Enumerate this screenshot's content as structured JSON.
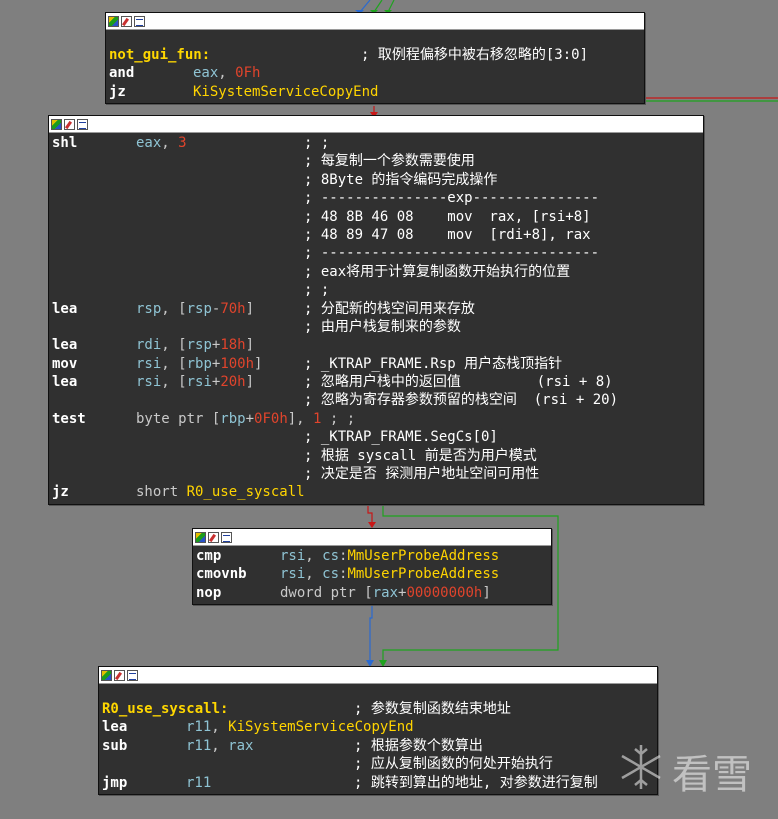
{
  "blocks": {
    "b1": {
      "label": "not_gui_fun:",
      "label_comment": "; 取例程偏移中被右移忽略的[3:0]",
      "lines": [
        {
          "mn": "and",
          "op": [
            {
              "t": "eax",
              "c": "reg"
            },
            {
              "t": ", ",
              "c": "ops"
            },
            {
              "t": "0Fh",
              "c": "num"
            }
          ],
          "cm": ""
        },
        {
          "mn": "jz",
          "op": [
            {
              "t": "KiSystemServiceCopyEnd",
              "c": "sym"
            }
          ],
          "cm": ""
        }
      ]
    },
    "b2": {
      "lines": [
        {
          "mn": "shl",
          "op": [
            {
              "t": "eax",
              "c": "reg"
            },
            {
              "t": ", ",
              "c": "ops"
            },
            {
              "t": "3",
              "c": "num"
            }
          ],
          "cm": "; ;"
        },
        {
          "mn": "",
          "op": [],
          "cm": "; 每复制一个参数需要使用"
        },
        {
          "mn": "",
          "op": [],
          "cm": "; 8Byte 的指令编码完成操作"
        },
        {
          "mn": "",
          "op": [],
          "cm": "; ---------------exp---------------"
        },
        {
          "mn": "",
          "op": [],
          "cm": "; 48 8B 46 08    mov  rax, [rsi+8]"
        },
        {
          "mn": "",
          "op": [],
          "cm": "; 48 89 47 08    mov  [rdi+8], rax"
        },
        {
          "mn": "",
          "op": [],
          "cm": "; ---------------------------------"
        },
        {
          "mn": "",
          "op": [],
          "cm": "; eax将用于计算复制函数开始执行的位置"
        },
        {
          "mn": "",
          "op": [],
          "cm": "; ;"
        },
        {
          "mn": "lea",
          "op": [
            {
              "t": "rsp",
              "c": "reg"
            },
            {
              "t": ", [",
              "c": "ops"
            },
            {
              "t": "rsp",
              "c": "reg"
            },
            {
              "t": "-",
              "c": "ops"
            },
            {
              "t": "70h",
              "c": "num"
            },
            {
              "t": "]",
              "c": "ops"
            }
          ],
          "cm": "; 分配新的栈空间用来存放"
        },
        {
          "mn": "",
          "op": [],
          "cm": "; 由用户栈复制来的参数"
        },
        {
          "mn": "lea",
          "op": [
            {
              "t": "rdi",
              "c": "reg"
            },
            {
              "t": ", [",
              "c": "ops"
            },
            {
              "t": "rsp",
              "c": "reg"
            },
            {
              "t": "+",
              "c": "ops"
            },
            {
              "t": "18h",
              "c": "num"
            },
            {
              "t": "]",
              "c": "ops"
            }
          ],
          "cm": ""
        },
        {
          "mn": "mov",
          "op": [
            {
              "t": "rsi",
              "c": "reg"
            },
            {
              "t": ", [",
              "c": "ops"
            },
            {
              "t": "rbp",
              "c": "reg"
            },
            {
              "t": "+",
              "c": "ops"
            },
            {
              "t": "100h",
              "c": "num"
            },
            {
              "t": "]",
              "c": "ops"
            }
          ],
          "cm": "; _KTRAP_FRAME.Rsp 用户态栈顶指针"
        },
        {
          "mn": "lea",
          "op": [
            {
              "t": "rsi",
              "c": "reg"
            },
            {
              "t": ", [",
              "c": "ops"
            },
            {
              "t": "rsi",
              "c": "reg"
            },
            {
              "t": "+",
              "c": "ops"
            },
            {
              "t": "20h",
              "c": "num"
            },
            {
              "t": "]",
              "c": "ops"
            }
          ],
          "cm": "; 忽略用户栈中的返回值         (rsi + 8)"
        },
        {
          "mn": "",
          "op": [],
          "cm": "; 忽略为寄存器参数预留的栈空间  (rsi + 20)"
        },
        {
          "mn": "test",
          "op": [
            {
              "t": "byte ptr [",
              "c": "ops"
            },
            {
              "t": "rbp",
              "c": "reg"
            },
            {
              "t": "+",
              "c": "ops"
            },
            {
              "t": "0F0h",
              "c": "num"
            },
            {
              "t": "], ",
              "c": "ops"
            },
            {
              "t": "1",
              "c": "num"
            },
            {
              "t": " ; ;",
              "c": "ops"
            }
          ],
          "cm": ""
        },
        {
          "mn": "",
          "op": [],
          "cm": "; _KTRAP_FRAME.SegCs[0]"
        },
        {
          "mn": "",
          "op": [],
          "cm": "; 根据 syscall 前是否为用户模式"
        },
        {
          "mn": "",
          "op": [],
          "cm": "; 决定是否 探测用户地址空间可用性"
        },
        {
          "mn": "jz",
          "op": [
            {
              "t": "short ",
              "c": "ops"
            },
            {
              "t": "R0_use_syscall",
              "c": "sym"
            }
          ],
          "cm": ""
        }
      ]
    },
    "b3": {
      "lines": [
        {
          "mn": "cmp",
          "op": [
            {
              "t": "rsi",
              "c": "reg"
            },
            {
              "t": ", ",
              "c": "ops"
            },
            {
              "t": "cs",
              "c": "segr"
            },
            {
              "t": ":",
              "c": "ops"
            },
            {
              "t": "MmUserProbeAddress",
              "c": "sym"
            }
          ],
          "cm": ""
        },
        {
          "mn": "cmovnb",
          "op": [
            {
              "t": "rsi",
              "c": "reg"
            },
            {
              "t": ", ",
              "c": "ops"
            },
            {
              "t": "cs",
              "c": "segr"
            },
            {
              "t": ":",
              "c": "ops"
            },
            {
              "t": "MmUserProbeAddress",
              "c": "sym"
            }
          ],
          "cm": ""
        },
        {
          "mn": "nop",
          "op": [
            {
              "t": "dword ptr [",
              "c": "ops"
            },
            {
              "t": "rax",
              "c": "reg"
            },
            {
              "t": "+",
              "c": "ops"
            },
            {
              "t": "00000000h",
              "c": "num"
            },
            {
              "t": "]",
              "c": "ops"
            }
          ],
          "cm": ""
        }
      ]
    },
    "b4": {
      "label": "R0_use_syscall:",
      "label_comment": "; 参数复制函数结束地址",
      "lines": [
        {
          "mn": "lea",
          "op": [
            {
              "t": "r11",
              "c": "reg"
            },
            {
              "t": ", ",
              "c": "ops"
            },
            {
              "t": "KiSystemServiceCopyEnd",
              "c": "sym"
            }
          ],
          "cm": ""
        },
        {
          "mn": "sub",
          "op": [
            {
              "t": "r11",
              "c": "reg"
            },
            {
              "t": ", ",
              "c": "ops"
            },
            {
              "t": "rax",
              "c": "reg"
            }
          ],
          "cm": "; 根据参数个数算出"
        },
        {
          "mn": "",
          "op": [],
          "cm": "; 应从复制函数的何处开始执行"
        },
        {
          "mn": "jmp",
          "op": [
            {
              "t": "r11",
              "c": "reg"
            }
          ],
          "cm": "; 跳转到算出的地址, 对参数进行复制"
        }
      ]
    }
  },
  "watermark": {
    "text": "看雪",
    "icon": "snowflake-icon"
  },
  "colors": {
    "background": "#7f7f7f",
    "block_bg": "#303030",
    "label": "#ffd700",
    "register": "#8fc4d4",
    "immediate": "#e0442c",
    "symbol": "#ffd400",
    "edge_taken": "#1fa31f",
    "edge_fallthrough": "#c81818",
    "edge_normal": "#2a6ad0"
  }
}
